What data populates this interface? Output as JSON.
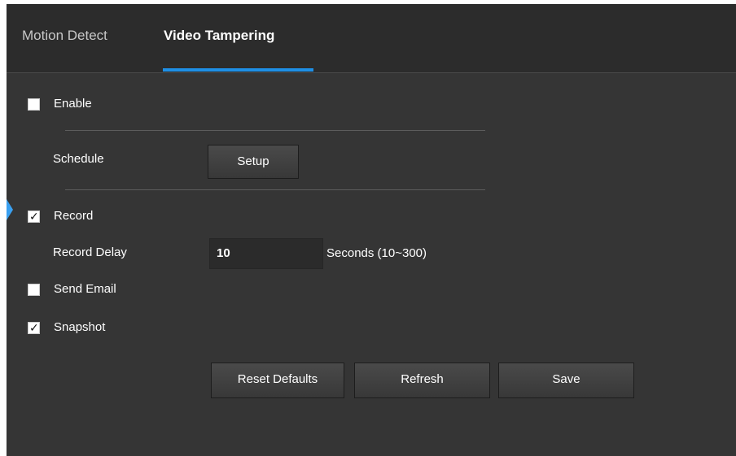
{
  "tabs": [
    {
      "label": "Motion Detect",
      "active": false
    },
    {
      "label": "Video Tampering",
      "active": true
    }
  ],
  "enable": {
    "label": "Enable",
    "checked": false
  },
  "schedule": {
    "label": "Schedule",
    "button_label": "Setup"
  },
  "record": {
    "label": "Record",
    "checked": true
  },
  "record_delay": {
    "label": "Record Delay",
    "value": "10",
    "unit": "Seconds (10~300)"
  },
  "send_email": {
    "label": "Send Email",
    "checked": false
  },
  "snapshot": {
    "label": "Snapshot",
    "checked": true
  },
  "buttons": {
    "reset_defaults": "Reset Defaults",
    "refresh": "Refresh",
    "save": "Save"
  },
  "colors": {
    "accent": "#1e90e6",
    "background": "#353535",
    "tabbar": "#2c2c2c"
  }
}
